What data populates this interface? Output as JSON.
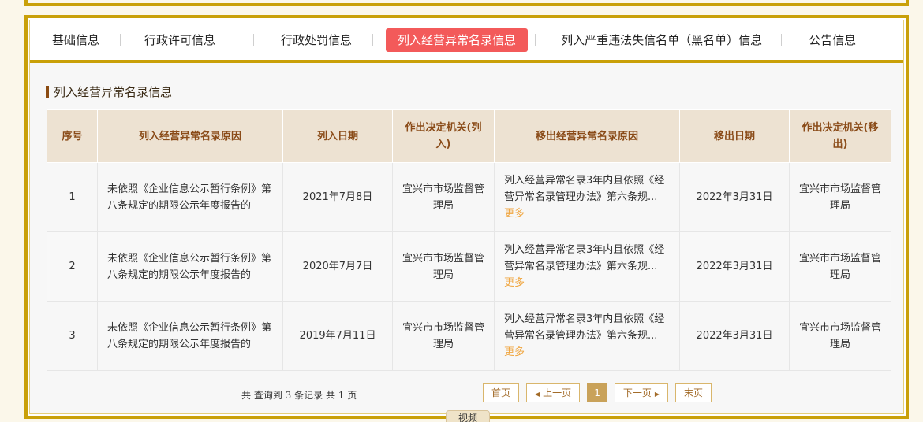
{
  "tabs": [
    {
      "label": "基础信息"
    },
    {
      "label": "行政许可信息"
    },
    {
      "label": "行政处罚信息"
    },
    {
      "label": "列入经营异常名录信息"
    },
    {
      "label": "列入严重违法失信名单（黑名单）信息"
    },
    {
      "label": "公告信息"
    }
  ],
  "section": {
    "title": "列入经营异常名录信息"
  },
  "table": {
    "headers": [
      "序号",
      "列入经营异常名录原因",
      "列入日期",
      "作出决定机关(列入)",
      "移出经营异常名录原因",
      "移出日期",
      "作出决定机关(移出)"
    ],
    "rows": [
      {
        "no": "1",
        "reason_in": "未依照《企业信息公示暂行条例》第八条规定的期限公示年度报告的",
        "date_in": "2021年7月8日",
        "org_in": "宜兴市市场监督管理局",
        "reason_out": "列入经营异常名录3年内且依照《经营异常名录管理办法》第六条规...",
        "more": "更多",
        "date_out": "2022年3月31日",
        "org_out": "宜兴市市场监督管理局"
      },
      {
        "no": "2",
        "reason_in": "未依照《企业信息公示暂行条例》第八条规定的期限公示年度报告的",
        "date_in": "2020年7月7日",
        "org_in": "宜兴市市场监督管理局",
        "reason_out": "列入经营异常名录3年内且依照《经营异常名录管理办法》第六条规...",
        "more": "更多",
        "date_out": "2022年3月31日",
        "org_out": "宜兴市市场监督管理局"
      },
      {
        "no": "3",
        "reason_in": "未依照《企业信息公示暂行条例》第八条规定的期限公示年度报告的",
        "date_in": "2019年7月11日",
        "org_in": "宜兴市市场监督管理局",
        "reason_out": "列入经营异常名录3年内且依照《经营异常名录管理办法》第六条规...",
        "more": "更多",
        "date_out": "2022年3月31日",
        "org_out": "宜兴市市场监督管理局"
      }
    ]
  },
  "pager": {
    "info_prefix": "共 查询到",
    "count": "3",
    "info_middle": "条记录 共",
    "pages": "1",
    "info_suffix": "页",
    "first": "首页",
    "prev": "上一页",
    "current": "1",
    "next": "下一页",
    "last": "末页"
  },
  "floating": {
    "video": "视频"
  },
  "colors": {
    "accent": "#c9a008",
    "active_tab": "#f35a5a",
    "header_bg": "#ede2d2",
    "header_text": "#8a4b18",
    "more_link": "#f0a640"
  }
}
